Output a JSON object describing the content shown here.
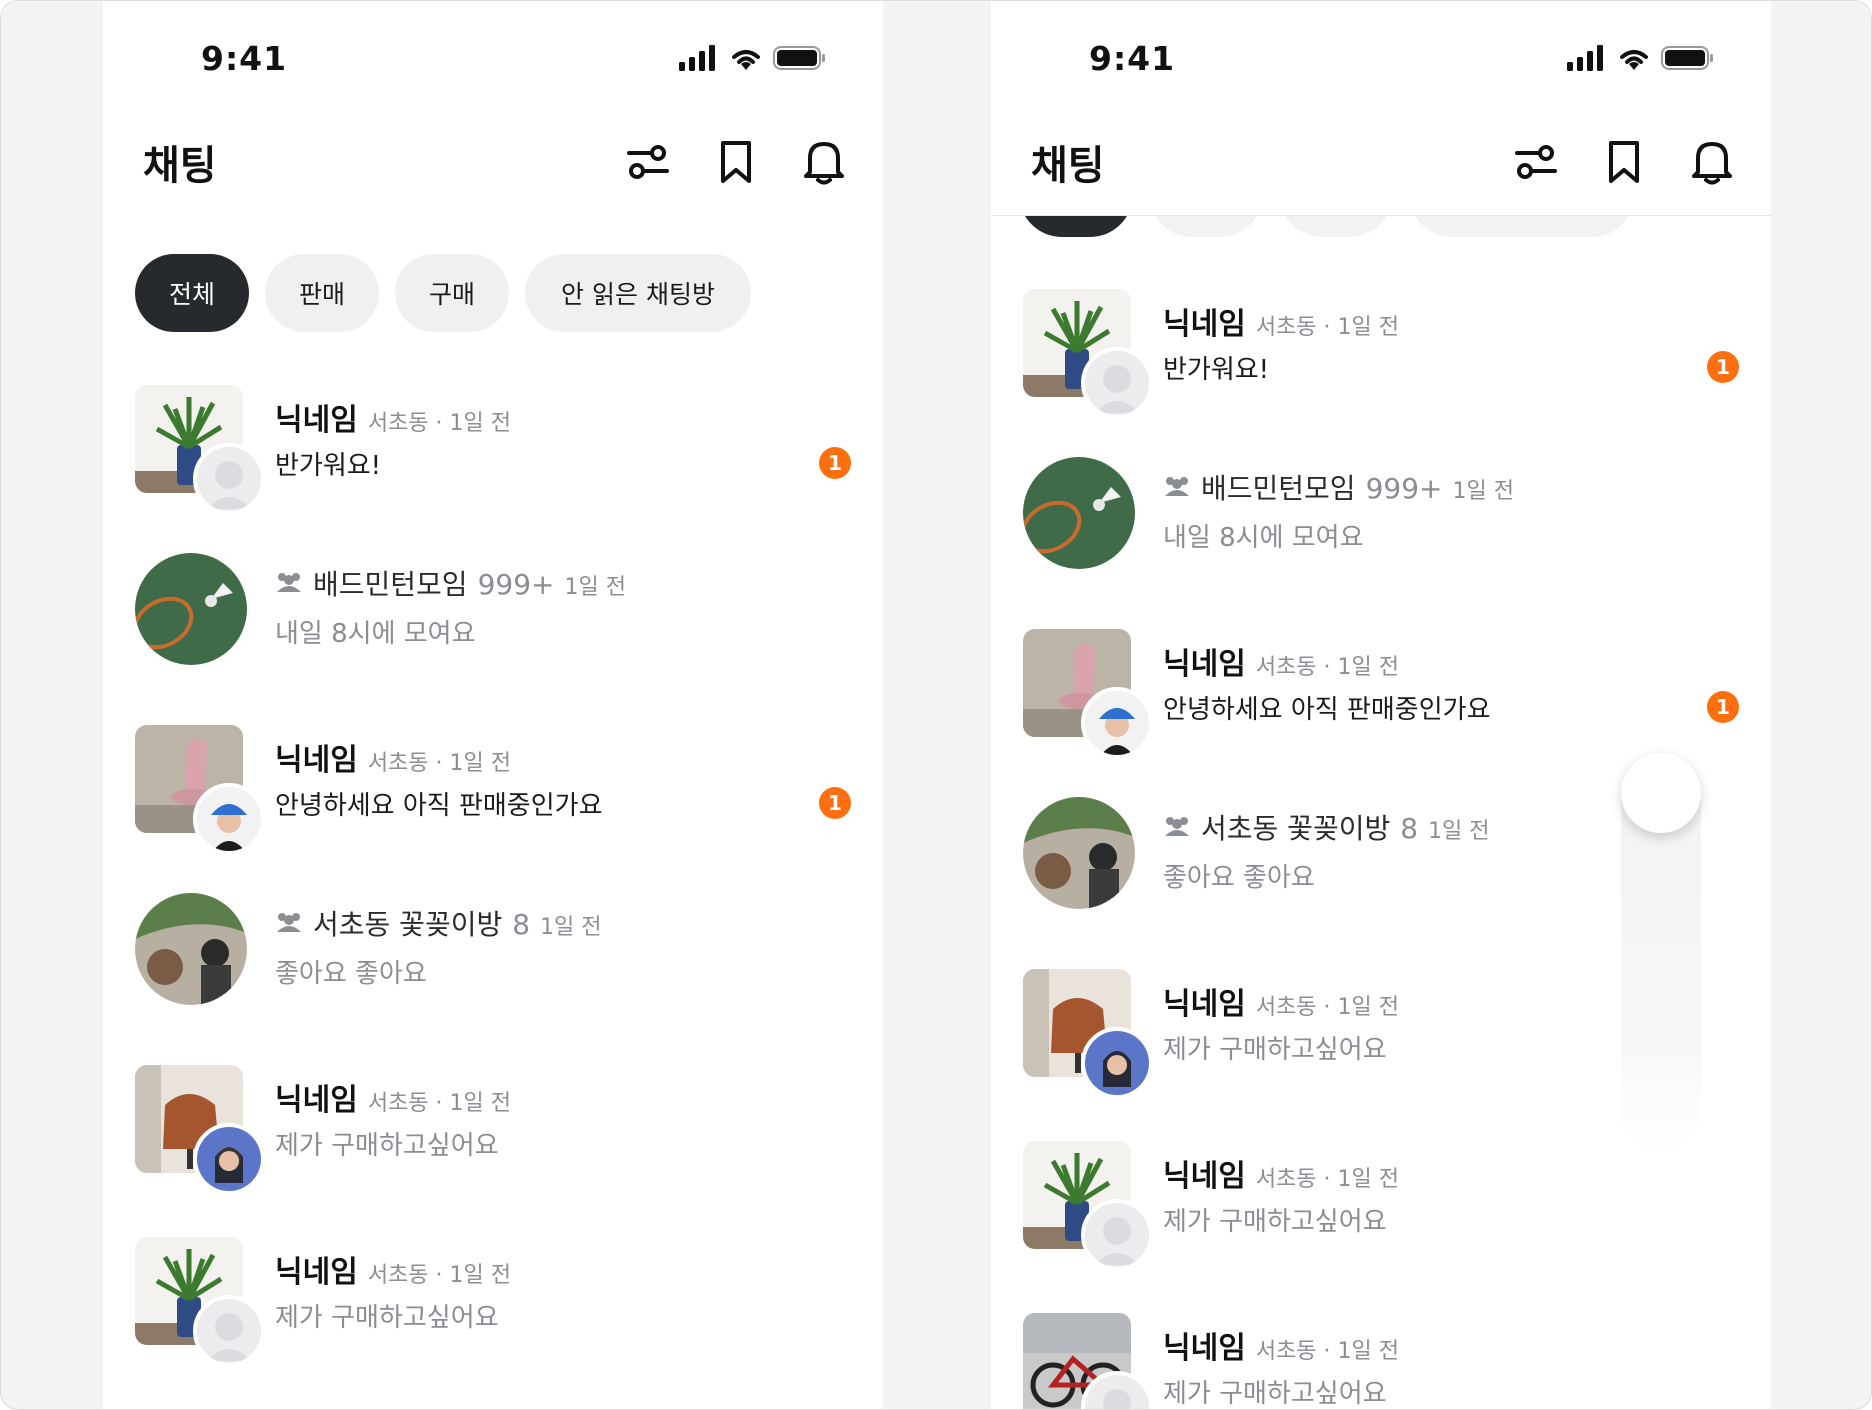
{
  "status": {
    "time": "9:41"
  },
  "header": {
    "title": "채팅"
  },
  "filters": [
    "전체",
    "판매",
    "구매",
    "안 읽은 채팅방"
  ],
  "rows": [
    {
      "kind": "person",
      "name": "닉네임",
      "meta": "서초동 · 1일 전",
      "message": "반가워요!",
      "unread": "1",
      "thumb": "plant",
      "avatar": "default"
    },
    {
      "kind": "group",
      "name": "배드민턴모임",
      "count": "999+",
      "meta": "1일 전",
      "message": "내일 8시에 모여요",
      "unread": "",
      "thumb": "badminton"
    },
    {
      "kind": "person",
      "name": "닉네임",
      "meta": "서초동 · 1일 전",
      "message": "안녕하세요 아직 판매중인가요",
      "unread": "1",
      "thumb": "pink-chair",
      "avatar": "woman-blue-cap"
    },
    {
      "kind": "group",
      "name": "서초동 꽃꽂이방",
      "count": "8",
      "meta": "1일 전",
      "message": "좋아요 좋아요",
      "unread": "",
      "thumb": "flowers"
    },
    {
      "kind": "person",
      "name": "닉네임",
      "meta": "서초동 · 1일 전",
      "message": "제가 구매하고싶어요",
      "unread": "",
      "thumb": "leather-chair",
      "avatar": "woman-blue-bg"
    },
    {
      "kind": "person",
      "name": "닉네임",
      "meta": "서초동 · 1일 전",
      "message": "제가 구매하고싶어요",
      "unread": "",
      "thumb": "plant",
      "avatar": "default"
    },
    {
      "kind": "person",
      "name": "닉네임",
      "meta": "서초동 · 1일 전",
      "message": "제가 구매하고싶어요",
      "unread": "",
      "thumb": "bicycle",
      "avatar": "default"
    }
  ],
  "icons": {
    "filter": "sliders-icon",
    "bookmark": "bookmark-icon",
    "bell": "bell-icon",
    "group": "group-icon",
    "signal": "signal-icon",
    "wifi": "wifi-icon",
    "battery": "battery-icon"
  },
  "colors": {
    "accent": "#ff6f0f",
    "active_chip": "#26292e",
    "muted": "#8a8d93"
  }
}
